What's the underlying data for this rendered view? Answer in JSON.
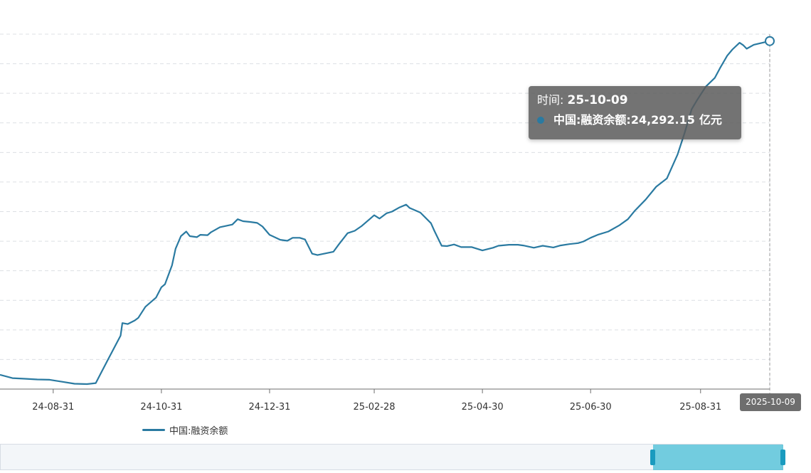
{
  "chart_data": {
    "type": "line",
    "title": "",
    "xlabel": "",
    "ylabel": "",
    "x_tick_labels": [
      "24-08-31",
      "24-10-31",
      "24-12-31",
      "25-02-28",
      "25-04-30",
      "25-06-30",
      "25-08-31"
    ],
    "series": [
      {
        "name": "中国:融资余额",
        "unit": "亿元",
        "color": "#2a7aa1",
        "points": [
          [
            "2024-08-01",
            14230
          ],
          [
            "2024-08-08",
            14130
          ],
          [
            "2024-08-15",
            14110
          ],
          [
            "2024-08-22",
            14090
          ],
          [
            "2024-08-29",
            14080
          ],
          [
            "2024-09-05",
            14020
          ],
          [
            "2024-09-12",
            13960
          ],
          [
            "2024-09-19",
            13950
          ],
          [
            "2024-09-24",
            13980
          ],
          [
            "2024-09-27",
            14290
          ],
          [
            "2024-09-30",
            14600
          ],
          [
            "2024-10-08",
            15410
          ],
          [
            "2024-10-09",
            15790
          ],
          [
            "2024-10-12",
            15760
          ],
          [
            "2024-10-16",
            15870
          ],
          [
            "2024-10-18",
            15950
          ],
          [
            "2024-10-22",
            16280
          ],
          [
            "2024-10-28",
            16560
          ],
          [
            "2024-10-31",
            16870
          ],
          [
            "2024-11-02",
            16960
          ],
          [
            "2024-11-06",
            17530
          ],
          [
            "2024-11-08",
            18030
          ],
          [
            "2024-11-11",
            18410
          ],
          [
            "2024-11-14",
            18550
          ],
          [
            "2024-11-16",
            18410
          ],
          [
            "2024-11-20",
            18380
          ],
          [
            "2024-11-22",
            18450
          ],
          [
            "2024-11-26",
            18440
          ],
          [
            "2024-11-28",
            18530
          ],
          [
            "2024-12-03",
            18680
          ],
          [
            "2024-12-10",
            18760
          ],
          [
            "2024-12-13",
            18920
          ],
          [
            "2024-12-16",
            18860
          ],
          [
            "2024-12-20",
            18840
          ],
          [
            "2024-12-24",
            18810
          ],
          [
            "2024-12-27",
            18700
          ],
          [
            "2024-12-31",
            18450
          ],
          [
            "2025-01-06",
            18300
          ],
          [
            "2025-01-10",
            18270
          ],
          [
            "2025-01-13",
            18360
          ],
          [
            "2025-01-17",
            18360
          ],
          [
            "2025-01-20",
            18310
          ],
          [
            "2025-01-24",
            17880
          ],
          [
            "2025-01-27",
            17840
          ],
          [
            "2025-02-05",
            17940
          ],
          [
            "2025-02-08",
            18160
          ],
          [
            "2025-02-13",
            18500
          ],
          [
            "2025-02-17",
            18570
          ],
          [
            "2025-02-21",
            18720
          ],
          [
            "2025-02-26",
            18950
          ],
          [
            "2025-02-28",
            19040
          ],
          [
            "2025-03-03",
            18940
          ],
          [
            "2025-03-07",
            19100
          ],
          [
            "2025-03-10",
            19150
          ],
          [
            "2025-03-14",
            19270
          ],
          [
            "2025-03-18",
            19360
          ],
          [
            "2025-03-20",
            19260
          ],
          [
            "2025-03-26",
            19120
          ],
          [
            "2025-04-01",
            18800
          ],
          [
            "2025-04-03",
            18560
          ],
          [
            "2025-04-07",
            18120
          ],
          [
            "2025-04-10",
            18110
          ],
          [
            "2025-04-14",
            18160
          ],
          [
            "2025-04-18",
            18080
          ],
          [
            "2025-04-24",
            18080
          ],
          [
            "2025-04-30",
            17980
          ],
          [
            "2025-05-06",
            18060
          ],
          [
            "2025-05-09",
            18120
          ],
          [
            "2025-05-15",
            18150
          ],
          [
            "2025-05-20",
            18150
          ],
          [
            "2025-05-23",
            18130
          ],
          [
            "2025-05-29",
            18060
          ],
          [
            "2025-06-03",
            18120
          ],
          [
            "2025-06-09",
            18070
          ],
          [
            "2025-06-13",
            18130
          ],
          [
            "2025-06-18",
            18170
          ],
          [
            "2025-06-23",
            18200
          ],
          [
            "2025-06-26",
            18250
          ],
          [
            "2025-06-30",
            18360
          ],
          [
            "2025-07-04",
            18450
          ],
          [
            "2025-07-10",
            18550
          ],
          [
            "2025-07-16",
            18730
          ],
          [
            "2025-07-21",
            18920
          ],
          [
            "2025-07-25",
            19180
          ],
          [
            "2025-07-31",
            19510
          ],
          [
            "2025-08-06",
            19900
          ],
          [
            "2025-08-12",
            20150
          ],
          [
            "2025-08-18",
            20870
          ],
          [
            "2025-08-22",
            21520
          ],
          [
            "2025-08-26",
            22240
          ],
          [
            "2025-08-29",
            22510
          ],
          [
            "2025-09-03",
            22920
          ],
          [
            "2025-09-08",
            23180
          ],
          [
            "2025-09-11",
            23480
          ],
          [
            "2025-09-15",
            23850
          ],
          [
            "2025-09-18",
            24040
          ],
          [
            "2025-09-22",
            24240
          ],
          [
            "2025-09-24",
            24170
          ],
          [
            "2025-09-26",
            24060
          ],
          [
            "2025-09-30",
            24180
          ],
          [
            "2025-10-09",
            24292.15
          ]
        ]
      }
    ],
    "ylim": [
      13800,
      24500
    ],
    "grid": true,
    "legend_position": "bottom"
  },
  "tooltip": {
    "time_label": "时间: ",
    "time_value": "25-10-09",
    "series_label": "中国:融资余额: ",
    "value": "24,292.15",
    "unit": "亿元"
  },
  "axis_pointer_label": "2025-10-09",
  "legend": {
    "label": "中国:融资余额"
  },
  "data_zoom": {
    "window_start_fraction": 0.835,
    "window_end_fraction": 1.0
  },
  "colors": {
    "line": "#2a7aa1",
    "grid": "#dcdfe4",
    "axis": "#6e6e6e",
    "tooltip_bg": "#5a5a5a",
    "slider_window": "#47bdd6"
  }
}
